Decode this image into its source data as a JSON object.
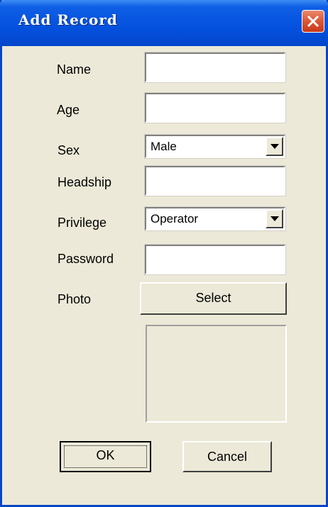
{
  "window": {
    "title": "Add Record"
  },
  "form": {
    "name_label": "Name",
    "name_value": "",
    "age_label": "Age",
    "age_value": "",
    "sex_label": "Sex",
    "sex_value": "Male",
    "headship_label": "Headship",
    "headship_value": "",
    "privilege_label": "Privilege",
    "privilege_value": "Operator",
    "password_label": "Password",
    "password_value": "",
    "photo_label": "Photo",
    "select_label": "Select"
  },
  "buttons": {
    "ok_label": "OK",
    "cancel_label": "Cancel"
  },
  "icons": {
    "close": "close-icon",
    "dropdown": "chevron-down-icon"
  },
  "colors": {
    "titlebar": "#0451de",
    "window_bg": "#ece9d8",
    "close_button": "#dc5b39"
  }
}
